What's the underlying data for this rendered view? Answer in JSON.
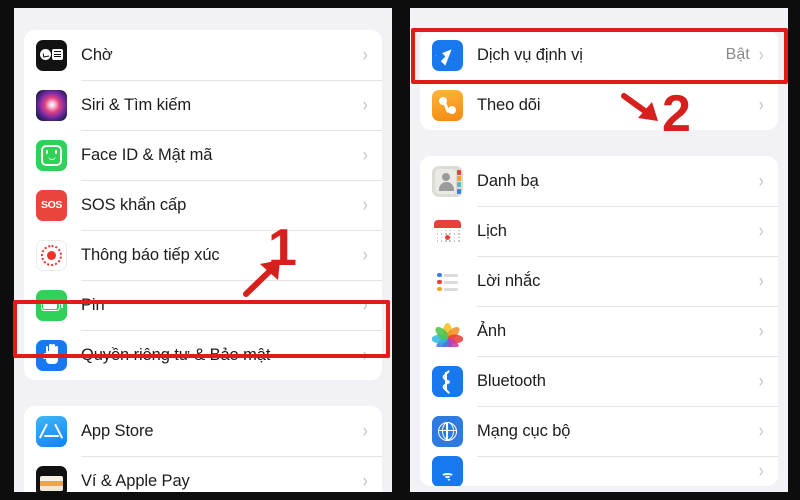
{
  "meta": {
    "app": "iOS Settings",
    "language": "vi",
    "panel_count": 2
  },
  "left_panel": {
    "name": "settings-main-list",
    "groups": [
      {
        "name": "group-primary",
        "rows": [
          {
            "icon": "standby-icon",
            "label": "Chờ",
            "value": "",
            "chevron": "›"
          },
          {
            "icon": "siri-search-icon",
            "label": "Siri & Tìm kiếm",
            "value": "",
            "chevron": "›"
          },
          {
            "icon": "face-id-icon",
            "label": "Face ID & Mật mã",
            "value": "",
            "chevron": "›"
          },
          {
            "icon": "emergency-sos-icon",
            "label": "SOS khẩn cấp",
            "value": "",
            "chevron": "›"
          },
          {
            "icon": "exposure-notification-icon",
            "label": "Thông báo tiếp xúc",
            "value": "",
            "chevron": "›"
          },
          {
            "icon": "battery-icon",
            "label": "Pin",
            "value": "",
            "chevron": "›"
          },
          {
            "icon": "privacy-hand-icon",
            "label": "Quyền riêng tư & Bảo mật",
            "value": "",
            "chevron": "›",
            "highlighted": true
          }
        ]
      },
      {
        "name": "group-store",
        "rows": [
          {
            "icon": "app-store-icon",
            "label": "App Store",
            "value": "",
            "chevron": "›"
          },
          {
            "icon": "wallet-icon",
            "label": "Ví & Apple Pay",
            "value": "",
            "chevron": "›"
          }
        ]
      }
    ]
  },
  "right_panel": {
    "name": "privacy-security-list",
    "groups": [
      {
        "name": "group-location",
        "rows": [
          {
            "icon": "location-services-icon",
            "label": "Dịch vụ định vị",
            "value": "Bật",
            "chevron": "›",
            "highlighted": true
          },
          {
            "icon": "tracking-icon",
            "label": "Theo dõi",
            "value": "",
            "chevron": "›"
          }
        ]
      },
      {
        "name": "group-app-data",
        "rows": [
          {
            "icon": "contacts-icon",
            "label": "Danh bạ",
            "value": "",
            "chevron": "›"
          },
          {
            "icon": "calendar-icon",
            "label": "Lịch",
            "value": "",
            "chevron": "›"
          },
          {
            "icon": "reminders-icon",
            "label": "Lời nhắc",
            "value": "",
            "chevron": "›"
          },
          {
            "icon": "photos-icon",
            "label": "Ảnh",
            "value": "",
            "chevron": "›"
          },
          {
            "icon": "bluetooth-icon",
            "label": "Bluetooth",
            "value": "",
            "chevron": "›"
          },
          {
            "icon": "local-network-icon",
            "label": "Mạng cục bộ",
            "value": "",
            "chevron": "›"
          },
          {
            "icon": "wifi-icon",
            "label": "",
            "value": "",
            "chevron": "›",
            "clipped": true
          }
        ]
      }
    ]
  },
  "annotations": {
    "accent_color": "#e01b18",
    "step_one": {
      "label": "1",
      "name": "step-1-marker"
    },
    "step_two": {
      "label": "2",
      "name": "step-2-marker"
    },
    "arrow_one": {
      "name": "step-1-arrow",
      "direction": "up-right"
    },
    "arrow_two": {
      "name": "step-2-arrow",
      "direction": "down-right"
    },
    "highlight_one": {
      "name": "highlight-privacy-row"
    },
    "highlight_two": {
      "name": "highlight-location-services-row"
    }
  },
  "colors": {
    "panel_bg": "#f2f1f6",
    "row_bg": "#ffffff",
    "frame": "#0d0d0d",
    "label_text": "#1c1c1e",
    "value_text": "#8a8a8e",
    "chevron": "#c3c3c7",
    "separator": "#e4e3e8"
  }
}
